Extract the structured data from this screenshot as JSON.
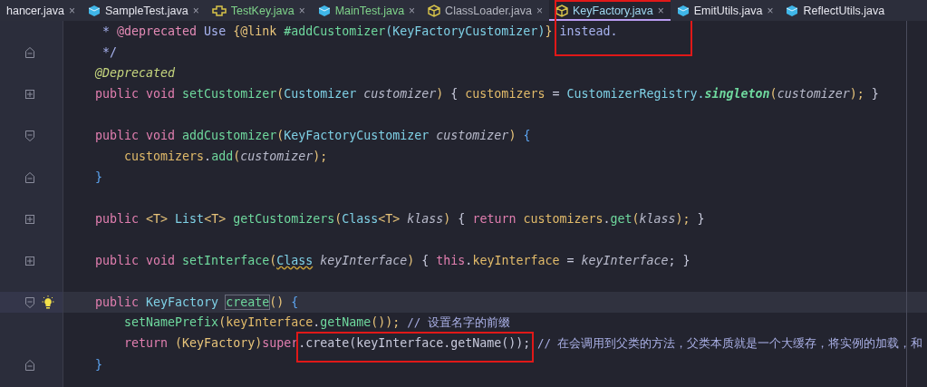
{
  "tabs": [
    {
      "label": "hancer.java",
      "color": "#e6e6ee",
      "selected": false,
      "close": "×",
      "boxed": false
    },
    {
      "label": "SampleTest.java",
      "kind": "class",
      "color": "#e6e6ee",
      "selected": false,
      "close": "×",
      "boxed": false
    },
    {
      "label": "TestKey.java",
      "kind": "test",
      "color": "#7fd38a",
      "selected": false,
      "close": "×",
      "boxed": false
    },
    {
      "label": "MainTest.java",
      "kind": "class",
      "color": "#7fd38a",
      "selected": false,
      "close": "×",
      "boxed": false
    },
    {
      "label": "ClassLoader.java",
      "kind": "hollow",
      "color": "#b4b6c0",
      "selected": false,
      "close": "×",
      "boxed": false
    },
    {
      "label": "KeyFactory.java",
      "kind": "hollow",
      "color": "#9fd8f0",
      "selected": true,
      "close": "×",
      "boxed": true
    },
    {
      "label": "EmitUtils.java",
      "kind": "class",
      "color": "#e6e6ee",
      "selected": false,
      "close": "×",
      "boxed": false
    },
    {
      "label": "ReflectUtils.java",
      "kind": "class",
      "color": "#e6e6ee",
      "selected": false,
      "boxed": false
    }
  ],
  "lines": [
    {
      "current": false,
      "tokens": [
        {
          "text": "     * ",
          "kind": "doc"
        },
        {
          "text": "@deprecated",
          "kind": "doctag"
        },
        {
          "text": " Use ",
          "kind": "doc"
        },
        {
          "text": "{@link ",
          "kind": "paren"
        },
        {
          "text": "#addCustomizer",
          "kind": "method"
        },
        {
          "text": "(KeyFactoryCustomizer)",
          "kind": "type"
        },
        {
          "text": "}",
          "kind": "paren"
        },
        {
          "text": " instead.",
          "kind": "doc"
        }
      ]
    },
    {
      "fold_marker": {
        "kind": "end"
      },
      "current": false,
      "tokens": [
        {
          "text": "     */",
          "kind": "doc"
        }
      ]
    },
    {
      "current": false,
      "tokens": [
        {
          "text": "    @Deprecated",
          "kind": "annotation"
        }
      ]
    },
    {
      "fold_marker": {
        "kind": "collapsed"
      },
      "current": false,
      "tokens": [
        {
          "text": "    public void ",
          "kind": "keyword"
        },
        {
          "text": "setCustomizer",
          "kind": "method"
        },
        {
          "text": "(",
          "kind": "paren"
        },
        {
          "text": "Customizer ",
          "kind": "type"
        },
        {
          "text": "customizer",
          "kind": "param"
        },
        {
          "text": ") ",
          "kind": "paren"
        },
        {
          "text": "{ ",
          "kind": "plain"
        },
        {
          "text": "customizers",
          "kind": "field"
        },
        {
          "text": " = ",
          "kind": "plain"
        },
        {
          "text": "CustomizerRegistry.",
          "kind": "type"
        },
        {
          "text": "singleton",
          "kind": "static"
        },
        {
          "text": "(",
          "kind": "paren"
        },
        {
          "text": "customizer",
          "kind": "param"
        },
        {
          "text": "); ",
          "kind": "paren"
        },
        {
          "text": "}",
          "kind": "plain"
        }
      ]
    },
    {
      "current": false
    },
    {
      "fold_marker": {
        "kind": "start"
      },
      "current": false,
      "tokens": [
        {
          "text": "    public void ",
          "kind": "keyword"
        },
        {
          "text": "addCustomizer",
          "kind": "method"
        },
        {
          "text": "(",
          "kind": "paren"
        },
        {
          "text": "KeyFactoryCustomizer ",
          "kind": "type"
        },
        {
          "text": "customizer",
          "kind": "param"
        },
        {
          "text": ") ",
          "kind": "paren"
        },
        {
          "text": "{",
          "kind": "brace"
        }
      ]
    },
    {
      "current": false,
      "tokens": [
        {
          "text": "        customizers",
          "kind": "field"
        },
        {
          "text": ".",
          "kind": "plain"
        },
        {
          "text": "add",
          "kind": "method"
        },
        {
          "text": "(",
          "kind": "paren"
        },
        {
          "text": "customizer",
          "kind": "param"
        },
        {
          "text": ");",
          "kind": "paren"
        }
      ]
    },
    {
      "fold_marker": {
        "kind": "end"
      },
      "current": false,
      "tokens": [
        {
          "text": "    }",
          "kind": "brace"
        }
      ]
    },
    {
      "current": false
    },
    {
      "fold_marker": {
        "kind": "collapsed"
      },
      "current": false,
      "tokens": [
        {
          "text": "    public ",
          "kind": "keyword"
        },
        {
          "text": "<T> ",
          "kind": "paren"
        },
        {
          "text": "List",
          "kind": "type"
        },
        {
          "text": "<T> ",
          "kind": "paren"
        },
        {
          "text": "getCustomizers",
          "kind": "method"
        },
        {
          "text": "(",
          "kind": "paren"
        },
        {
          "text": "Class",
          "kind": "type"
        },
        {
          "text": "<T> ",
          "kind": "paren"
        },
        {
          "text": "klass",
          "kind": "param"
        },
        {
          "text": ") ",
          "kind": "paren"
        },
        {
          "text": "{ ",
          "kind": "plain"
        },
        {
          "text": "return ",
          "kind": "keyword"
        },
        {
          "text": "customizers",
          "kind": "field"
        },
        {
          "text": ".",
          "kind": "plain"
        },
        {
          "text": "get",
          "kind": "method"
        },
        {
          "text": "(",
          "kind": "paren"
        },
        {
          "text": "klass",
          "kind": "param"
        },
        {
          "text": "); ",
          "kind": "paren"
        },
        {
          "text": "}",
          "kind": "plain"
        }
      ]
    },
    {
      "current": false
    },
    {
      "fold_marker": {
        "kind": "collapsed"
      },
      "current": false,
      "tokens": [
        {
          "text": "    public void ",
          "kind": "keyword"
        },
        {
          "text": "setInterface",
          "kind": "method"
        },
        {
          "text": "(",
          "kind": "paren"
        },
        {
          "text": "Class",
          "kind": "warn"
        },
        {
          "text": " keyInterface",
          "kind": "param"
        },
        {
          "text": ") ",
          "kind": "paren"
        },
        {
          "text": "{ ",
          "kind": "plain"
        },
        {
          "text": "this",
          "kind": "keyword"
        },
        {
          "text": ".",
          "kind": "plain"
        },
        {
          "text": "keyInterface",
          "kind": "field"
        },
        {
          "text": " = ",
          "kind": "plain"
        },
        {
          "text": "keyInterface",
          "kind": "param"
        },
        {
          "text": "; ",
          "kind": "plain"
        },
        {
          "text": "}",
          "kind": "plain"
        }
      ]
    },
    {
      "current": false
    },
    {
      "fold_marker": {
        "kind": "start"
      },
      "current": true,
      "bulb": true,
      "tokens": [
        {
          "text": "    public ",
          "kind": "keyword"
        },
        {
          "text": "KeyFactory ",
          "kind": "type"
        },
        {
          "text": "create",
          "kind": "usage"
        },
        {
          "text": "() ",
          "kind": "paren"
        },
        {
          "text": "{",
          "kind": "brace"
        }
      ]
    },
    {
      "current": false,
      "tokens": [
        {
          "text": "        setNamePrefix",
          "kind": "method"
        },
        {
          "text": "(",
          "kind": "paren"
        },
        {
          "text": "keyInterface",
          "kind": "field"
        },
        {
          "text": ".",
          "kind": "plain"
        },
        {
          "text": "getName",
          "kind": "method"
        },
        {
          "text": "()); ",
          "kind": "paren"
        },
        {
          "text": "// 设置名字的前缀",
          "kind": "comment"
        }
      ]
    },
    {
      "current": false,
      "tokens": [
        {
          "text": "        return ",
          "kind": "keyword"
        },
        {
          "text": "(KeyFactory)",
          "kind": "paren"
        },
        {
          "text": "super",
          "kind": "keyword"
        },
        {
          "text": ".create(keyInterface.getName());",
          "kind": "plain",
          "boxed": true
        },
        {
          "text": " // 在会调用到父类的方法，父类本质就是一个大缓存，将实例的加载，和",
          "kind": "comment"
        }
      ]
    },
    {
      "fold_marker": {
        "kind": "end"
      },
      "current": false,
      "tokens": [
        {
          "text": "    }",
          "kind": "brace"
        }
      ]
    }
  ]
}
